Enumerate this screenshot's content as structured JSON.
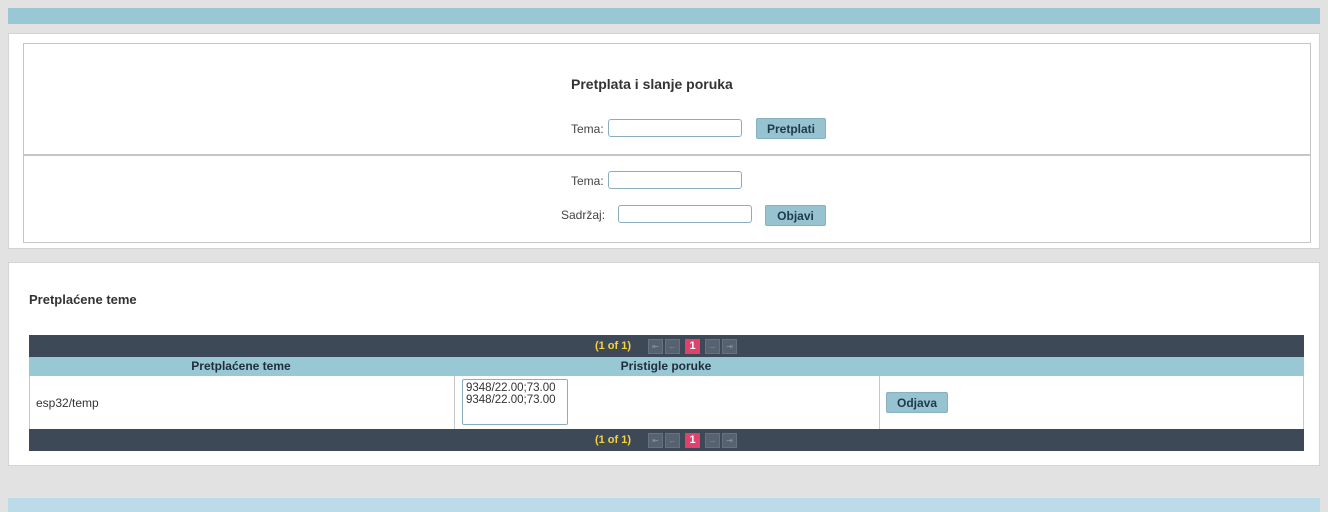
{
  "subscribe": {
    "title": "Pretplata i slanje poruka",
    "topic_label": "Tema:",
    "topic_value": "",
    "button": "Pretplati"
  },
  "publish": {
    "topic_label": "Tema:",
    "topic_value": "",
    "content_label": "Sadržaj:",
    "content_value": "",
    "button": "Objavi"
  },
  "subscriptions": {
    "title": "Pretplaćene teme",
    "paginator": {
      "count": "(1 of 1)",
      "current_page": "1"
    },
    "columns": [
      "Pretplaćene teme",
      "Pristigle poruke",
      ""
    ],
    "rows": [
      {
        "topic": "esp32/temp",
        "messages": [
          "9348/22.00;73.00",
          "9348/22.00;73.00"
        ],
        "action": "Odjava"
      }
    ]
  },
  "colors": {
    "accent": "#98c8d3",
    "paginator_bg": "#3e4957",
    "active_page": "#e0426c",
    "count_text": "#f7d23c"
  }
}
